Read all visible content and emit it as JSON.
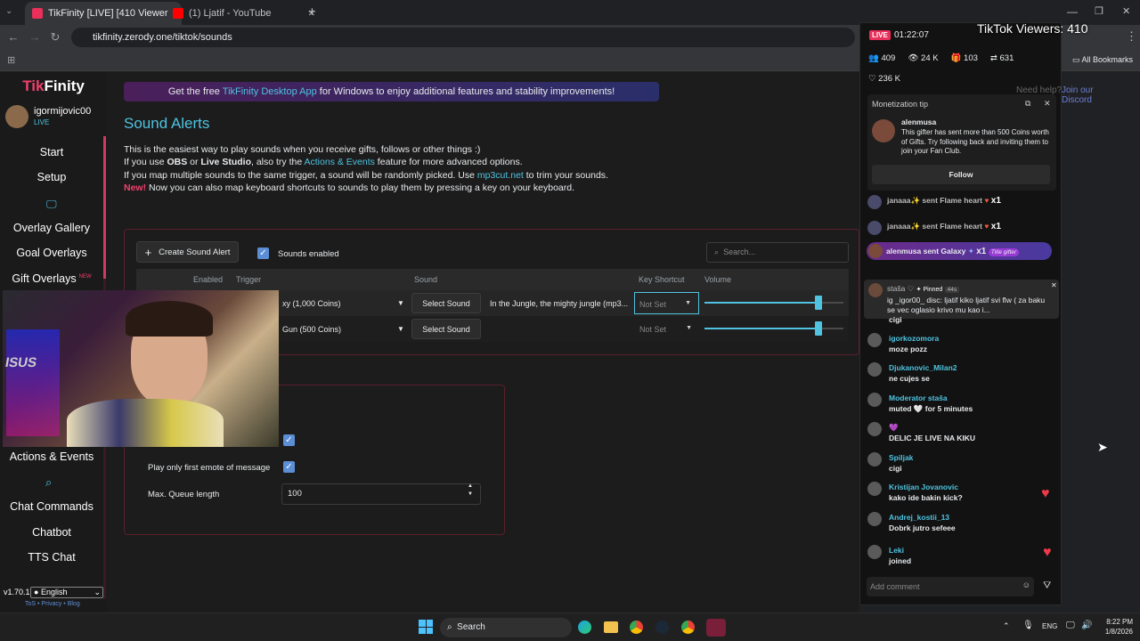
{
  "browser": {
    "tabs": [
      {
        "label": "TikFinity [LIVE] [410 Viewer",
        "color": "#e8305a"
      },
      {
        "label": "(1) Ljatif - YouTube",
        "color": "#ff0000"
      }
    ],
    "url": "tikfinity.zerody.one/tiktok/sounds",
    "bookmarks_label": "All Bookmarks"
  },
  "sidebar": {
    "logo_a": "Tik",
    "logo_b": "Finity",
    "username": "igormijovic00",
    "status": "LIVE",
    "items": [
      "Start",
      "Setup",
      "Overlay Gallery",
      "Goal Overlays",
      "Gift Overlays",
      "Actions & Events",
      "Chat Commands",
      "Chatbot",
      "TTS Chat"
    ],
    "new_badge": "NEW",
    "version": "v1.70.1",
    "language": "English",
    "footer": [
      "ToS",
      "Privacy",
      "Blog"
    ]
  },
  "banner": {
    "pre": "Get the free ",
    "link": "TikFinity Desktop App",
    "post": " for Windows to enjoy additional features and stability improvements!"
  },
  "header_right": {
    "help": "Need help?",
    "discord": "Join our Discord"
  },
  "page": {
    "title": "Sound Alerts",
    "line1": "This is the easiest way to play sounds when you receive gifts, follows or other things :)",
    "line2_a": "If you use ",
    "line2_b": "OBS",
    "line2_c": " or ",
    "line2_d": "Live Studio",
    "line2_e": ", also try the ",
    "line2_link": "Actions & Events",
    "line2_f": " feature for more advanced options.",
    "line3_a": "If you map multiple sounds to the same trigger, a sound will be randomly picked. Use ",
    "line3_link": "mp3cut.net",
    "line3_b": " to trim your sounds.",
    "line4_new": "New!",
    "line4": " Now you can also map keyboard shortcuts to sounds to play them by pressing a key on your keyboard."
  },
  "toolbar": {
    "create": "Create Sound Alert",
    "sounds_enabled": "Sounds enabled",
    "search_placeholder": "Search..."
  },
  "table": {
    "headers": [
      "Enabled",
      "Trigger",
      "Sound",
      "Key Shortcut",
      "Volume"
    ],
    "rows": [
      {
        "trigger": "xy (1,000 Coins)",
        "button": "Select Sound",
        "sound": "In the Jungle, the mighty jungle (mp3...",
        "key": "Not Set",
        "volume": 0.82
      },
      {
        "trigger": "Gun (500 Coins)",
        "button": "Select Sound",
        "sound": "",
        "key": "Not Set",
        "volume": 0.82
      }
    ]
  },
  "settings": {
    "emote_label": "Play only first emote of message",
    "queue_label": "Max. Queue length",
    "queue_value": "100"
  },
  "tiktok": {
    "overlay_title": "TikTok Viewers: 410",
    "live": "LIVE",
    "time": "01:22:07",
    "stats": [
      "409",
      "24 K",
      "103",
      "631"
    ],
    "likes": "236 K",
    "tip_title": "Monetization tip",
    "tip_user": "alenmusa",
    "tip_text": "This gifter has sent more than 500 Coins worth of Gifts. Try following back and inviting them to join your Fan Club.",
    "follow": "Follow",
    "gifts": [
      {
        "user": "janaaa✨",
        "text": "sent Flame heart",
        "count": "x1"
      },
      {
        "user": "janaaa✨",
        "text": "sent Flame heart",
        "count": "x1"
      },
      {
        "user": "alenmusa",
        "text": "sent Galaxy",
        "count": "x1",
        "badge": "Title gifter"
      }
    ],
    "pinned": {
      "user": "staša",
      "label": "Pinned",
      "age": "44s",
      "text": "ig _igor00_ disc: ljatif kiko ljatif svi flw ( za baku se vec oglasio krivo mu kao i..."
    },
    "chat": [
      {
        "user": "",
        "text": "cigi"
      },
      {
        "user": "igorkozomora",
        "text": "moze pozz"
      },
      {
        "user": "Djukanovic_Milan2",
        "text": "ne cujes se"
      },
      {
        "user": "Moderator staša",
        "text": "muted 🤍 for 5 minutes"
      },
      {
        "user": "💜",
        "text": "DELIC JE LIVE NA KIKU"
      },
      {
        "user": "Spiljak",
        "text": "cigi"
      },
      {
        "user": "Kristijan Jovanovic",
        "text": "kako ide bakin kick?"
      },
      {
        "user": "Andrej_kostii_13",
        "text": "Dobrk jutro sefeee"
      },
      {
        "user": "Leki",
        "text": "joined"
      }
    ],
    "add_comment": "Add comment"
  },
  "taskbar": {
    "search": "Search",
    "lang": "ENG",
    "time": "8:22 PM",
    "date": "1/8/2026"
  }
}
